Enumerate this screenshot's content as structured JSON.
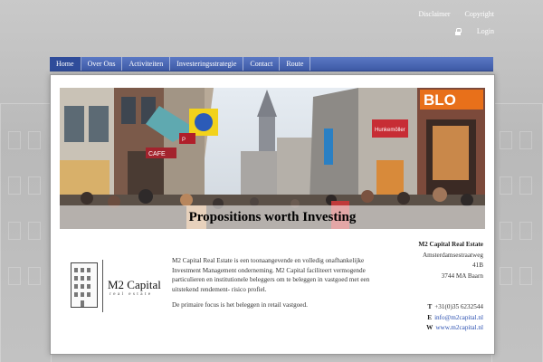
{
  "top_links": {
    "disclaimer": "Disclaimer",
    "copyright": "Copyright",
    "login": "Login"
  },
  "nav": [
    {
      "label": "Home",
      "active": true
    },
    {
      "label": "Over Ons"
    },
    {
      "label": "Activiteiten"
    },
    {
      "label": "Investeringsstrategie"
    },
    {
      "label": "Contact"
    },
    {
      "label": "Route"
    }
  ],
  "hero": {
    "tagline": "Propositions worth Investing",
    "signs": {
      "bl": "BLO",
      "parking": "P",
      "cafe": "CAFE",
      "hunkemoller": "Hunkemöller"
    }
  },
  "logo": {
    "name": "M2 Capital",
    "sub": "real estate"
  },
  "description": {
    "p1": "M2 Capital Real Estate is een toonaangevende en volledig onafhankelijke Investment Management onderneming. M2 Capital faciliteert vermogende particulieren en institutionele beleggers om te beleggen in vastgoed met een uitstekend rendement- risico profiel.",
    "p2": "De primaire focus is het beleggen in retail vastgoed."
  },
  "contact": {
    "company": "M2 Capital Real Estate",
    "street": "Amsterdamsestraatweg",
    "number": "41B",
    "city": "3744 MA Baarn",
    "phone_label": "T",
    "phone": "+31(0)35 6232544",
    "email_label": "E",
    "email": "info@m2capital.nl",
    "web_label": "W",
    "web": "www.m2capital.nl"
  },
  "colors": {
    "nav": "#4663b3",
    "nav_active": "#2f4c9a",
    "link": "#2a4fb0",
    "bl_sign": "#e8701a"
  }
}
